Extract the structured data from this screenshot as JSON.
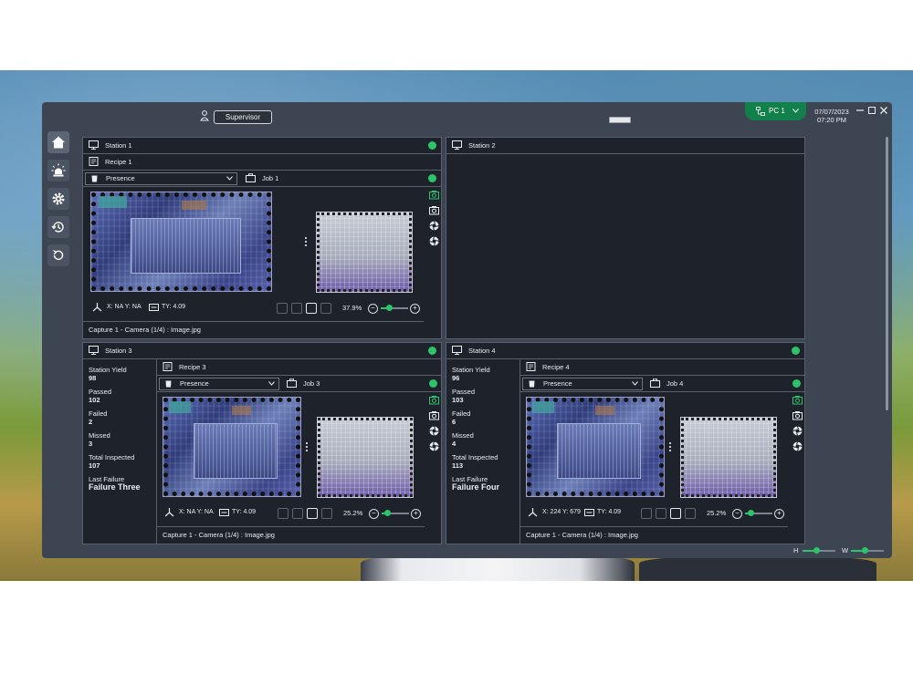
{
  "header": {
    "user_role": "Supervisor",
    "pc_label": "PC 1",
    "date": "07/07/2023",
    "time": "07:20 PM"
  },
  "sidebar": {
    "items": [
      {
        "icon": "home-icon",
        "active": true
      },
      {
        "icon": "alarm-icon",
        "active": false
      },
      {
        "icon": "gear-icon",
        "active": false
      },
      {
        "icon": "history-icon",
        "active": false
      },
      {
        "icon": "refresh-icon",
        "active": false
      }
    ]
  },
  "stations": {
    "s1": {
      "title": "Station 1",
      "recipe": "Recipe 1",
      "mode": "Presence",
      "job": "Job 1",
      "coords": "X: NA Y: NA",
      "ty": "TY: 4.09",
      "zoom": "37.9%",
      "zoom_fraction": 0.3,
      "caption": "Capture 1 - Camera (1/4) : Image.jpg"
    },
    "s2": {
      "title": "Station 2"
    },
    "s3": {
      "title": "Station 3",
      "recipe": "Recipe 3",
      "mode": "Presence",
      "job": "Job 3",
      "coords": "X: NA Y: NA",
      "ty": "TY: 4.09",
      "zoom": "25.2%",
      "zoom_fraction": 0.2,
      "caption": "Capture 1 - Camera (1/4) : Image.jpg",
      "stats": {
        "yield_label": "Station Yield",
        "yield": "98",
        "passed_label": "Passed",
        "passed": "102",
        "failed_label": "Failed",
        "failed": "2",
        "missed_label": "Missed",
        "missed": "3",
        "total_label": "Total Inspected",
        "total": "107",
        "last_label": "Last Failure",
        "last": "Failure Three"
      }
    },
    "s4": {
      "title": "Station 4",
      "recipe": "Recipe 4",
      "mode": "Presence",
      "job": "Job 4",
      "coords": "X: 224 Y: 679",
      "ty": "TY: 4.09",
      "zoom": "25.2%",
      "zoom_fraction": 0.2,
      "caption": "Capture 1 - Camera (1/4) : Image.jpg",
      "stats": {
        "yield_label": "Station Yield",
        "yield": "96",
        "passed_label": "Passed",
        "passed": "103",
        "failed_label": "Failed",
        "failed": "6",
        "missed_label": "Missed",
        "missed": "4",
        "total_label": "Total Inspected",
        "total": "113",
        "last_label": "Last Failure",
        "last": "Failure Four"
      }
    }
  },
  "footer": {
    "h_label": "H",
    "w_label": "W"
  },
  "colors": {
    "accent": "#2cc36b",
    "pill": "#12804a",
    "panel": "#1d222b",
    "frame": "#3d4553"
  }
}
